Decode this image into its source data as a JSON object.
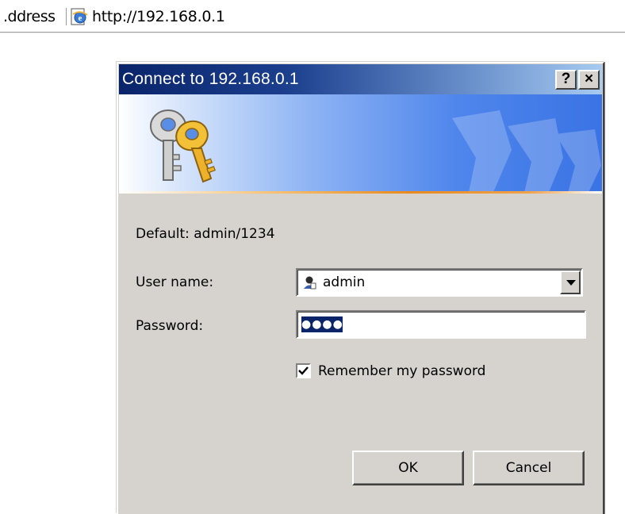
{
  "browser": {
    "address_label": ".ddress",
    "url": "http://192.168.0.1",
    "icons": {
      "page": "ie-page-icon"
    }
  },
  "dialog": {
    "title": "Connect to 192.168.0.1",
    "help_label": "?",
    "close_label": "×",
    "banner_icon": "keys-icon",
    "default_text": "Default: admin/1234",
    "user_label": "User name:",
    "user_value": "admin",
    "user_icon": "user-icon",
    "password_label": "Password:",
    "password_mask": "●●●●",
    "remember_label": "Remember my password",
    "remember_checked": true,
    "ok_label": "OK",
    "cancel_label": "Cancel"
  },
  "colors": {
    "title_start": "#0a246a",
    "title_end": "#a6caf0",
    "face": "#d6d3ce",
    "selection": "#0a246a"
  }
}
